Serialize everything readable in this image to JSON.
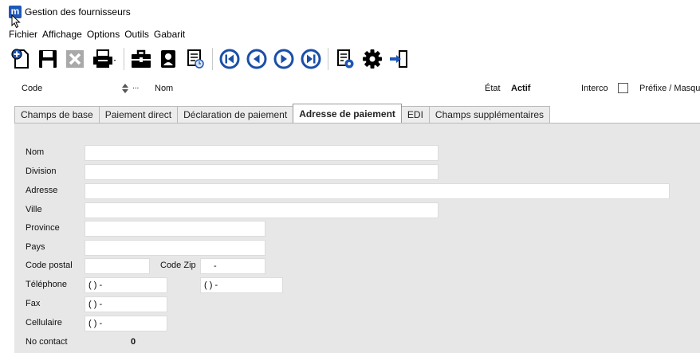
{
  "window": {
    "title": "Gestion des fournisseurs",
    "app_icon_letter": "m"
  },
  "menu": [
    "Fichier",
    "Affichage",
    "Options",
    "Outils",
    "Gabarit"
  ],
  "toolbar": {
    "icons": [
      "new-icon",
      "save-icon",
      "delete-icon",
      "print-icon",
      "briefcase-icon",
      "contact-card-icon",
      "calendar-icon",
      "first-icon",
      "previous-icon",
      "next-icon",
      "last-icon",
      "report-settings-icon",
      "gear-icon",
      "exit-icon"
    ]
  },
  "header": {
    "code_label": "Code",
    "code_ellipsis": "...",
    "nom_label": "Nom",
    "etat_label": "État",
    "etat_value": "Actif",
    "interco_label": "Interco",
    "prefixe_label": "Préfixe / Masque"
  },
  "tabs": [
    "Champs de base",
    "Paiement direct",
    "Déclaration de paiement",
    "Adresse de paiement",
    "EDI",
    "Champs supplémentaires"
  ],
  "active_tab": "Adresse de paiement",
  "form": {
    "nom_label": "Nom",
    "division_label": "Division",
    "adresse_label": "Adresse",
    "ville_label": "Ville",
    "province_label": "Province",
    "pays_label": "Pays",
    "code_postal_label": "Code postal",
    "code_zip_label": "Code Zip",
    "code_zip_value": "-",
    "telephone_label": "Téléphone",
    "telephone_value": "( )  -",
    "telephone2_value": "( )  -",
    "fax_label": "Fax",
    "fax_value": "( )  -",
    "cellulaire_label": "Cellulaire",
    "cellulaire_value": "( )  -",
    "no_contact_label": "No contact",
    "no_contact_value": "0"
  },
  "colors": {
    "accent": "#1d57b8",
    "panel": "#e7e7e7",
    "nav_blue": "#1a4fa8"
  }
}
